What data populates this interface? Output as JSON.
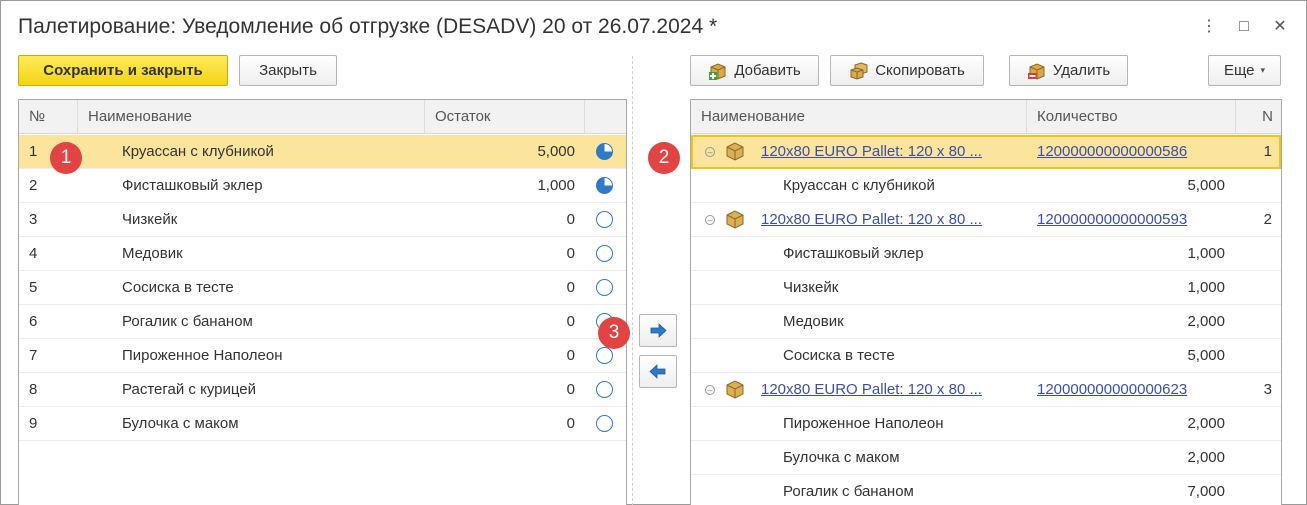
{
  "window": {
    "title": "Палетирование: Уведомление об отгрузке (DESADV) 20 от 26.07.2024 *",
    "controls": {
      "more": "⋮",
      "maximize": "□",
      "close": "✕"
    }
  },
  "toolbar_left": {
    "save_close": "Сохранить и закрыть",
    "close": "Закрыть"
  },
  "toolbar_right": {
    "add": "Добавить",
    "copy": "Скопировать",
    "delete": "Удалить",
    "more": "Еще"
  },
  "left_table": {
    "columns": [
      "№",
      "Наименование",
      "Остаток"
    ],
    "rows": [
      {
        "n": "1",
        "name": "Круассан с клубникой",
        "rest": "5,000",
        "pie": "partial",
        "selected": true
      },
      {
        "n": "2",
        "name": "Фисташковый эклер",
        "rest": "1,000",
        "pie": "partial",
        "selected": false
      },
      {
        "n": "3",
        "name": "Чизкейк",
        "rest": "0",
        "pie": "empty",
        "selected": false
      },
      {
        "n": "4",
        "name": "Медовик",
        "rest": "0",
        "pie": "empty",
        "selected": false
      },
      {
        "n": "5",
        "name": "Сосиска в тесте",
        "rest": "0",
        "pie": "empty",
        "selected": false
      },
      {
        "n": "6",
        "name": "Рогалик с бананом",
        "rest": "0",
        "pie": "empty",
        "selected": false
      },
      {
        "n": "7",
        "name": "Пироженное Наполеон",
        "rest": "0",
        "pie": "empty",
        "selected": false
      },
      {
        "n": "8",
        "name": "Растегай с курицей",
        "rest": "0",
        "pie": "empty",
        "selected": false
      },
      {
        "n": "9",
        "name": "Булочка с маком",
        "rest": "0",
        "pie": "empty",
        "selected": false
      }
    ]
  },
  "right_table": {
    "columns": [
      "Наименование",
      "Количество",
      "N"
    ],
    "rows": [
      {
        "type": "pallet",
        "name": "120x80 EURO Pallet:   120 x 80 ...",
        "qty": "120000000000000586",
        "n": "1",
        "selected": true
      },
      {
        "type": "item",
        "name": "Круассан с клубникой",
        "qty": "5,000"
      },
      {
        "type": "pallet",
        "name": "120x80 EURO Pallet:   120 x 80 ...",
        "qty": "120000000000000593",
        "n": "2",
        "selected": false
      },
      {
        "type": "item",
        "name": "Фисташковый эклер",
        "qty": "1,000"
      },
      {
        "type": "item",
        "name": "Чизкейк",
        "qty": "1,000"
      },
      {
        "type": "item",
        "name": "Медовик",
        "qty": "2,000"
      },
      {
        "type": "item",
        "name": "Сосиска в тесте",
        "qty": "5,000"
      },
      {
        "type": "pallet",
        "name": "120x80 EURO Pallet:   120 x 80 ...",
        "qty": "120000000000000623",
        "n": "3",
        "selected": false
      },
      {
        "type": "item",
        "name": "Пироженное Наполеон",
        "qty": "2,000"
      },
      {
        "type": "item",
        "name": "Булочка с маком",
        "qty": "2,000"
      },
      {
        "type": "item",
        "name": "Рогалик с бананом",
        "qty": "7,000"
      }
    ]
  },
  "badges": [
    "1",
    "2",
    "3"
  ],
  "colors": {
    "accent_yellow": "#f4d413",
    "selection": "#fbe49c",
    "badge": "#e24343",
    "link": "#3c4fa6",
    "arrow": "#2f79c9"
  }
}
